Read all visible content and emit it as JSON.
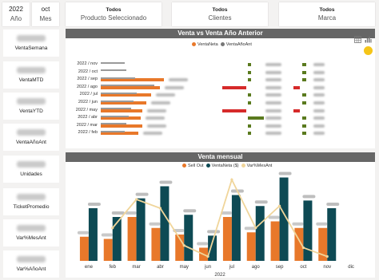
{
  "slicers": {
    "year": {
      "value": "2022",
      "label": "Año"
    },
    "month": {
      "value": "oct",
      "label": "Mes"
    },
    "product": {
      "title": "Todos",
      "label": "Producto Seleccionado"
    },
    "client": {
      "title": "Todos",
      "label": "Clientes"
    },
    "brand": {
      "title": "Todos",
      "label": "Marca"
    }
  },
  "kpis": [
    {
      "label": "VentaSemana"
    },
    {
      "label": "VentaMTD"
    },
    {
      "label": "VentaYTD"
    },
    {
      "label": "VentaAñoAnt"
    },
    {
      "label": "Unidades"
    },
    {
      "label": "TicketPromedio"
    },
    {
      "label": "Var%MesAnt"
    },
    {
      "label": "Var%AñoAnt"
    }
  ],
  "top_chart": {
    "title": "Venta vs Venta Año Anterior",
    "legend": [
      "VentaNeta",
      "VentaAñoAnt"
    ],
    "rows": [
      "2022 / nov",
      "2022 / oct",
      "2022 / sep",
      "2022 / ago",
      "2022 / jul",
      "2022 / jun",
      "2022 / may",
      "2022 / abr",
      "2022 / mar",
      "2022 / feb"
    ],
    "venta_neta": [
      0,
      80,
      0.88,
      0.82,
      0.7,
      0.63,
      0.58,
      0.55,
      0.58,
      0.52
    ],
    "venta_ant": [
      0.28,
      0.3,
      0.4,
      0.62,
      0.42,
      0.38,
      0.35,
      0.32,
      0.3,
      0.28
    ]
  },
  "chart_data": {
    "type": "bar",
    "title": "Venta mensual",
    "xlabel": "2022",
    "categories": [
      "ene",
      "feb",
      "mar",
      "abr",
      "may",
      "jun",
      "jul",
      "ago",
      "sep",
      "oct",
      "nov",
      "dic"
    ],
    "series": [
      {
        "name": "Sell Out",
        "values": [
          22,
          20,
          40,
          30,
          24,
          12,
          40,
          26,
          36,
          30,
          30,
          0
        ]
      },
      {
        "name": "VentaNeta ($)",
        "values": [
          48,
          40,
          57,
          68,
          42,
          23,
          60,
          50,
          76,
          55,
          48,
          0
        ]
      },
      {
        "name": "Var%MesAnt",
        "values": [
          null,
          30,
          56,
          48,
          14,
          4,
          74,
          30,
          50,
          12,
          4,
          null
        ]
      }
    ],
    "colors": {
      "sell_out": "#e8782a",
      "venta_neta": "#0e4a54",
      "var": "#f0d59a"
    }
  },
  "colors": {
    "orange": "#e8782a",
    "grey": "#777777",
    "red": "#d62a2a",
    "green": "#5a7a1e",
    "title_bar": "#666666"
  }
}
